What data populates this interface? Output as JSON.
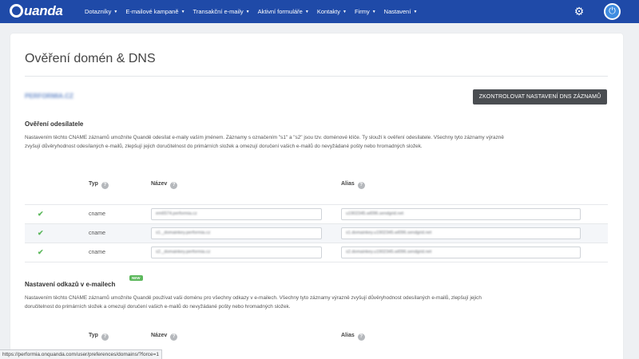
{
  "app": {
    "logo_text": "uanda"
  },
  "nav": {
    "items": [
      {
        "label": "Dotazníky"
      },
      {
        "label": "E-mailové kampaně"
      },
      {
        "label": "Transakční e-maily"
      },
      {
        "label": "Aktivní formuláře"
      },
      {
        "label": "Kontakty"
      },
      {
        "label": "Firmy"
      },
      {
        "label": "Nastavení"
      }
    ]
  },
  "page": {
    "title": "Ověření domén & DNS",
    "domain": "PERFORMIA.CZ",
    "check_button": "ZKONTROLOVAT NASTAVENÍ DNS ZÁZNAMŮ"
  },
  "sender": {
    "heading": "Ověření odesílatele",
    "description": "Nastavením těchto CNAME záznamů umožníte Quandě odesílat e-maily vaším jménem. Záznamy s označením \"s1\" a \"s2\" jsou tzv. doménové klíče. Ty slouží k ověření odesílatele. Všechny tyto záznamy výrazně zvyšují důvěryhodnost odesílaných e-mailů, zlepšují jejich doručitelnost do primárních složek a omezují doručení vašich e-mailů do nevyžádané pošty nebo hromadných složek.",
    "columns": {
      "type": "Typ",
      "name": "Název",
      "alias": "Alias"
    },
    "rows": [
      {
        "type": "cname",
        "name": "em6574.performia.cz",
        "alias": "u1902345.wl096.sendgrid.net"
      },
      {
        "type": "cname",
        "name": "s1._domainkey.performia.cz",
        "alias": "s1.domainkey.u1902345.wl096.sendgrid.net"
      },
      {
        "type": "cname",
        "name": "s2._domainkey.performia.cz",
        "alias": "s2.domainkey.u1902345.wl096.sendgrid.net"
      }
    ]
  },
  "links": {
    "heading": "Nastavení odkazů v e-mailech",
    "badge": "NEW",
    "description": "Nastavením těchto CNAME záznamů umožníte Quandě používat vaši doménu pro všechny odkazy v e-mailech. Všechny tyto záznamy výrazně zvyšují důvěryhodnost odesílaných e-mailů, zlepšují jejich doručitelnost do primárních složek a omezují doručení vašich e-mailů do nevyžádané pošty nebo hromadných složek.",
    "columns": {
      "type": "Typ",
      "name": "Název",
      "alias": "Alias"
    }
  },
  "statusbar": {
    "url": "https://performia.onquanda.com/user/preferences/domains/?force=1"
  },
  "colors": {
    "nav": "#1f4aa8",
    "success": "#5cb85c",
    "button": "#4a4d51"
  },
  "icons": [
    "settings-gear-icon",
    "power-icon",
    "help-icon",
    "check-icon"
  ]
}
